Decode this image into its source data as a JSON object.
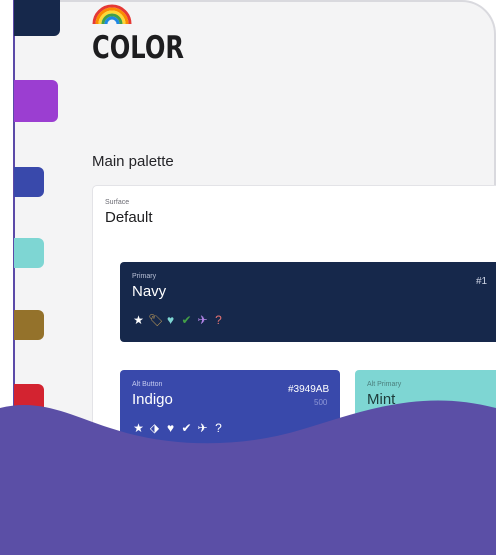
{
  "app": {
    "title": "COLOR",
    "emoji_icon": "rainbow-icon"
  },
  "main": {
    "section_heading": "Main palette",
    "surface": {
      "label": "Surface",
      "name": "Default"
    },
    "cards": [
      {
        "id": "navy",
        "label": "Primary",
        "name": "Navy",
        "hex": "#1",
        "shade": "",
        "color": "#16284B"
      },
      {
        "id": "indigo",
        "label": "Alt Button",
        "name": "Indigo",
        "hex": "#3949AB",
        "shade": "500",
        "color": "#3949AB"
      },
      {
        "id": "mint",
        "label": "Alt Primary",
        "name": "Mint",
        "hex": "",
        "shade": "",
        "color": "#7ED6D3"
      }
    ],
    "icons": [
      "star-icon",
      "tag-icon",
      "heart-icon",
      "double-check-icon",
      "flight-land-icon",
      "help-circle-icon"
    ]
  },
  "sidebar_swatches": [
    {
      "name": "purple",
      "color": "#9B3ED1"
    },
    {
      "name": "indigo",
      "color": "#3949AB"
    },
    {
      "name": "mint",
      "color": "#7ED6D3"
    },
    {
      "name": "gold",
      "color": "#94722B"
    },
    {
      "name": "red",
      "color": "#D32330"
    }
  ],
  "colors": {
    "wave": "#5B4FA6",
    "background": "#F4F4F5"
  }
}
